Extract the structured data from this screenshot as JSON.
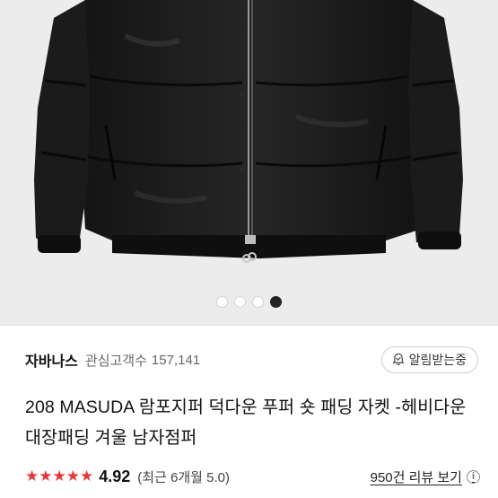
{
  "product_image": {
    "slide_count": 4,
    "active_slide": 4
  },
  "shop": {
    "name": "자바나스",
    "interest_label": "관심고객수",
    "interest_count": "157,141",
    "follow_label": "알림받는중",
    "follow_icon": "bell-check-icon"
  },
  "product": {
    "title": "208 MASUDA 람포지퍼 덕다운 푸퍼 숏 패딩 자켓 -헤비다운 대장패딩 겨울 남자점퍼"
  },
  "rating": {
    "stars": "★★★★★",
    "score": "4.92",
    "period_text": "(최근 6개월 5.0)",
    "review_link": "950건 리뷰 보기",
    "info_icon": "info-icon",
    "star_color": "#e5383b"
  }
}
